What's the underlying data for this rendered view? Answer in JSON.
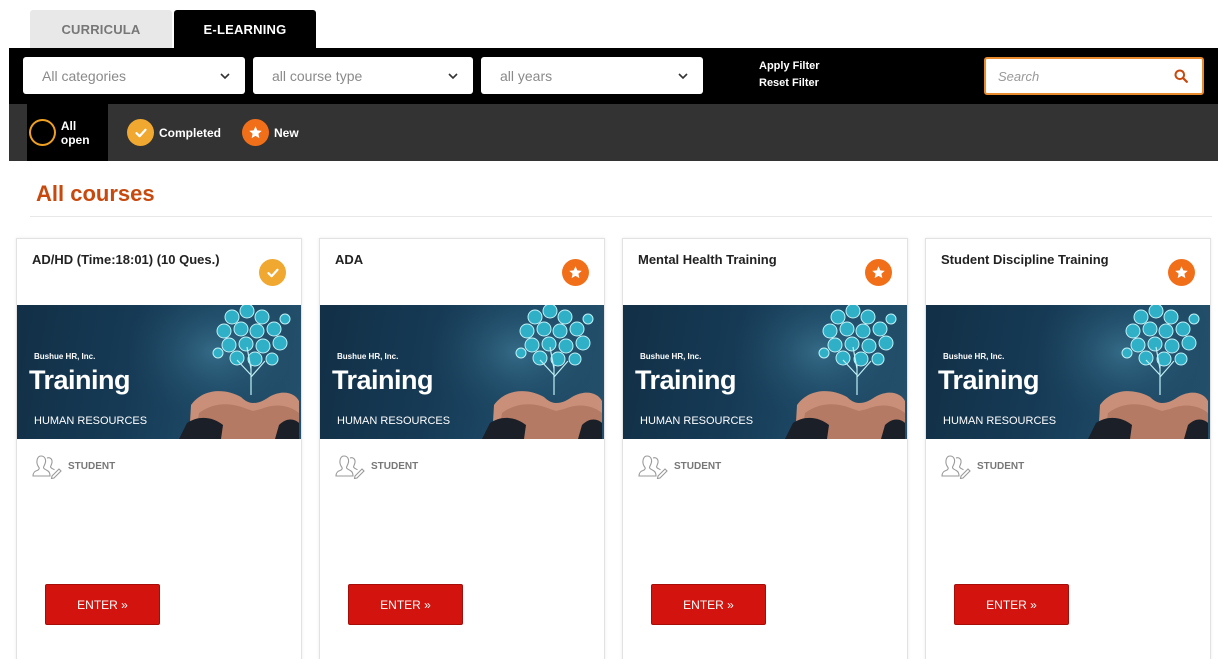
{
  "tabs": [
    {
      "label": "CURRICULA",
      "active": false
    },
    {
      "label": "E-LEARNING",
      "active": true
    }
  ],
  "filters": {
    "category_value": "All categories",
    "course_type_value": "all course type",
    "years_value": "all years",
    "apply_label": "Apply Filter",
    "reset_label": "Reset Filter",
    "search_placeholder": "Search"
  },
  "status": {
    "all_open": "All open",
    "completed": "Completed",
    "new": "New"
  },
  "page_title": "All courses",
  "image_text": {
    "company": "Bushue HR, Inc.",
    "headline": "Training",
    "subtitle": "HUMAN RESOURCES"
  },
  "courses": [
    {
      "title": "AD/HD (Time:18:01) (10 Ques.)",
      "status": "completed",
      "role": "STUDENT",
      "button": "ENTER »"
    },
    {
      "title": "ADA",
      "status": "new",
      "role": "STUDENT",
      "button": "ENTER »"
    },
    {
      "title": "Mental Health Training",
      "status": "new",
      "role": "STUDENT",
      "button": "ENTER »"
    },
    {
      "title": "Student Discipline Training",
      "status": "new",
      "role": "STUDENT",
      "button": "ENTER »"
    }
  ],
  "colors": {
    "accent_orange": "#f26f1a",
    "completed_gold": "#f0a830",
    "title_orange": "#c8490e",
    "enter_red": "#d2130e"
  }
}
